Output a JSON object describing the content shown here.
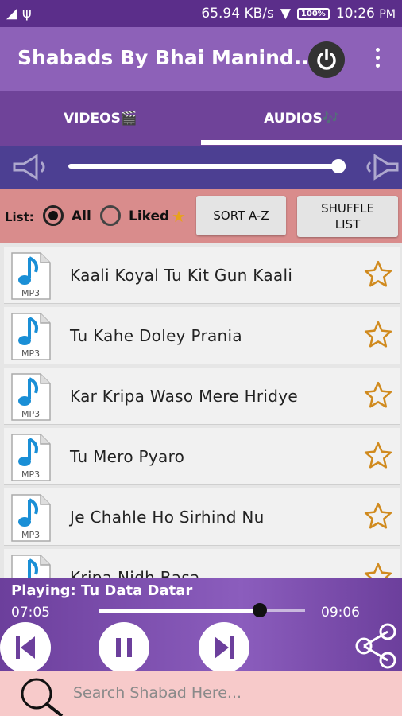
{
  "status_bar": {
    "network_speed": "65.94 KB/s",
    "battery": "100%",
    "time": "10:26",
    "time_suffix": "PM"
  },
  "app_bar": {
    "title": "Shabads By Bhai Manind..."
  },
  "tabs": [
    {
      "label": "VIDEOS🎬",
      "selected": false
    },
    {
      "label": "AUDIOS🎶",
      "selected": true
    }
  ],
  "volume": {
    "level": 0.97
  },
  "filter": {
    "list_label": "List:",
    "options": [
      {
        "label": "All",
        "selected": true
      },
      {
        "label": "Liked",
        "selected": false
      }
    ],
    "sort_label": "SORT A-Z",
    "shuffle_label": "SHUFFLE LIST"
  },
  "file_badge": "MP3",
  "tracks": [
    {
      "name": "Kaali Koyal Tu Kit Gun Kaali"
    },
    {
      "name": "Tu Kahe Doley Prania"
    },
    {
      "name": "Kar Kripa Waso Mere Hridye"
    },
    {
      "name": "Tu Mero Pyaro"
    },
    {
      "name": "Je Chahle Ho Sirhind Nu"
    },
    {
      "name": "Kripa Nidh Basa"
    }
  ],
  "player": {
    "now_playing": "Playing: Tu Data Datar",
    "current_time": "07:05",
    "duration": "09:06",
    "progress": 0.78
  },
  "search": {
    "placeholder": "Search Shabad Here..."
  },
  "colors": {
    "status_bar": "#5b2e8a",
    "app_bar": "#8d61b8",
    "tab_bar": "#6f4399",
    "volume_bar": "#4c3f92",
    "filter_bar": "#d98c8c",
    "search_bar": "#f7caca",
    "star": "#d08a1e"
  }
}
